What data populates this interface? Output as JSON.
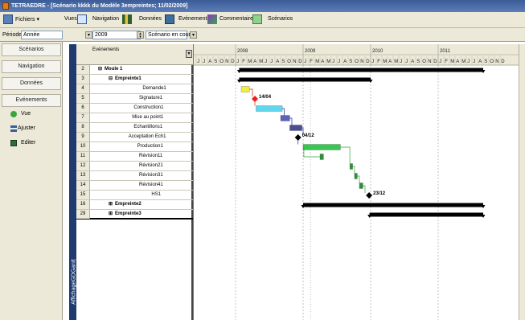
{
  "window": {
    "title": "TETRAEDRE - [Scénario kkkk du Modèle 3empreintes; 11/02/2009]"
  },
  "menu": {
    "items": [
      {
        "label": "Fichiers ▾",
        "icon": "file-icon"
      },
      {
        "label": "Vues",
        "icon": "vues-icon"
      },
      {
        "label": "Navigation",
        "icon": "navigation-icon"
      },
      {
        "label": "Données",
        "icon": "donnees-icon"
      },
      {
        "label": "Evénements",
        "icon": "evenements-icon"
      },
      {
        "label": "Commentaires",
        "icon": "commentaires-icon"
      },
      {
        "label": "Scénarios",
        "icon": "scenarios-icon"
      }
    ]
  },
  "toolbar": {
    "periode_label": "Période",
    "periode_value": "Année",
    "year_value": "2009",
    "scenario_value": "Scénario en cours"
  },
  "sidebar": {
    "buttons": [
      "Scénarios",
      "Navigation",
      "Données",
      "Evénements"
    ],
    "items": [
      {
        "label": "Vue",
        "icon": "vue-icon"
      },
      {
        "label": "Ajuster",
        "icon": "ajuster-icon"
      },
      {
        "label": "Editer",
        "icon": "editer-icon"
      }
    ]
  },
  "grid": {
    "header": "Evénements",
    "vertical_label": "AffichageGDGantt",
    "rows": [
      {
        "n": "2",
        "label": "Moule 1",
        "bold": true,
        "indent": 0,
        "toggle": "⊟"
      },
      {
        "n": "3",
        "label": "Empreinte1",
        "bold": true,
        "indent": 1,
        "toggle": "⊟"
      },
      {
        "n": "4",
        "label": "Demande1",
        "bold": false,
        "indent": 2,
        "toggle": ""
      },
      {
        "n": "5",
        "label": "Signature1",
        "bold": false,
        "indent": 2,
        "toggle": ""
      },
      {
        "n": "6",
        "label": "Construction1",
        "bold": false,
        "indent": 2,
        "toggle": ""
      },
      {
        "n": "7",
        "label": "Mise au point1",
        "bold": false,
        "indent": 2,
        "toggle": ""
      },
      {
        "n": "8",
        "label": "Echantillons1",
        "bold": false,
        "indent": 2,
        "toggle": ""
      },
      {
        "n": "9",
        "label": "Acceptation Ech1",
        "bold": false,
        "indent": 2,
        "toggle": ""
      },
      {
        "n": "10",
        "label": "Production1",
        "bold": false,
        "indent": 2,
        "toggle": ""
      },
      {
        "n": "11",
        "label": "Révision11",
        "bold": false,
        "indent": 2,
        "toggle": ""
      },
      {
        "n": "12",
        "label": "Révision21",
        "bold": false,
        "indent": 2,
        "toggle": ""
      },
      {
        "n": "13",
        "label": "Révision31",
        "bold": false,
        "indent": 2,
        "toggle": ""
      },
      {
        "n": "14",
        "label": "Révision41",
        "bold": false,
        "indent": 2,
        "toggle": ""
      },
      {
        "n": "15",
        "label": "HS1",
        "bold": false,
        "indent": 2,
        "toggle": ""
      },
      {
        "n": "16",
        "label": "Empreinte2",
        "bold": true,
        "indent": 1,
        "toggle": "⊞"
      },
      {
        "n": "29",
        "label": "Empreinte3",
        "bold": true,
        "indent": 1,
        "toggle": "⊞"
      }
    ]
  },
  "gantt": {
    "years": [
      "2008",
      "2009",
      "2010",
      "2011"
    ],
    "months": [
      "J",
      "J",
      "A",
      "S",
      "O",
      "N",
      "D",
      "J",
      "F",
      "M",
      "A",
      "M",
      "J",
      "J",
      "A",
      "S",
      "O",
      "N",
      "D",
      "J",
      "F",
      "M",
      "A",
      "M",
      "J",
      "J",
      "A",
      "S",
      "O",
      "N",
      "D",
      "J",
      "F",
      "M",
      "A",
      "M",
      "J",
      "J",
      "A",
      "S",
      "O",
      "N",
      "D",
      "J",
      "F",
      "M",
      "A",
      "M",
      "J",
      "J",
      "A",
      "S",
      "O",
      "N",
      "D"
    ],
    "milestones": {
      "signature": "14/04",
      "acceptation": "04/12",
      "hs": "23/12"
    },
    "colors": {
      "summary": "#000000",
      "demande": "#f2ee3a",
      "signature": "#e8211b",
      "construction": "#62d6ea",
      "mise_au_point": "#5a63b9",
      "echantillons": "#4a4f8f",
      "production": "#38c752",
      "revision": "#2f8f3a",
      "link_red": "#d81e1e",
      "link_blue": "#1b2e9e",
      "link_green": "#2aa534",
      "today_line": "#7f7f7f"
    }
  }
}
